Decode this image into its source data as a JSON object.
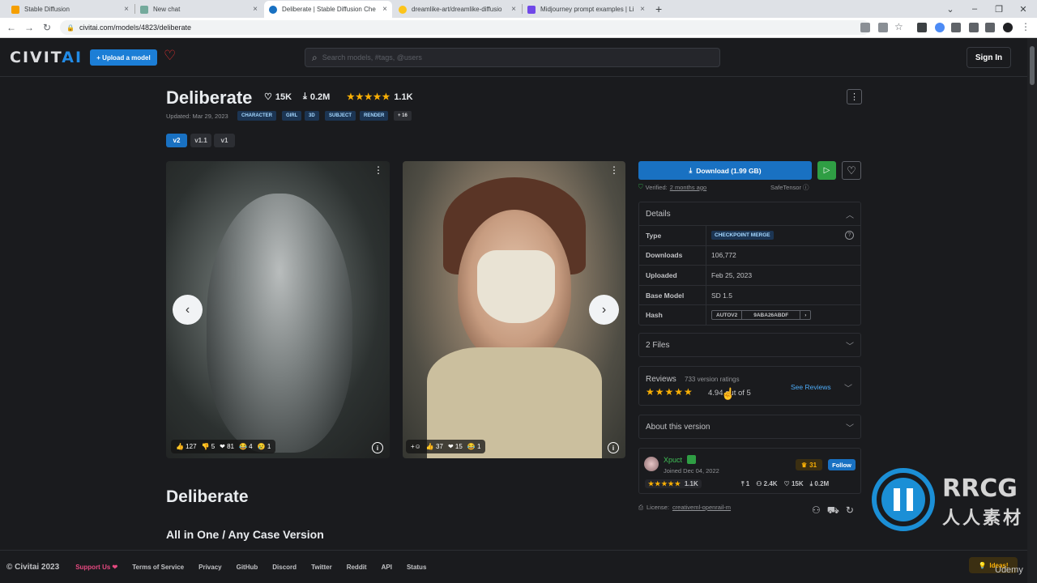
{
  "browser": {
    "tabs": [
      {
        "title": "Stable Diffusion"
      },
      {
        "title": "New chat"
      },
      {
        "title": "Deliberate | Stable Diffusion Che"
      },
      {
        "title": "dreamlike-art/dreamlike-diffusio"
      },
      {
        "title": "Midjourney prompt examples | Li"
      }
    ],
    "url": "civitai.com/models/4823/deliberate",
    "new_tab": "+",
    "close": "×"
  },
  "site": {
    "logo_a": "CIVIT",
    "logo_b": "AI",
    "upload_label": "+ Upload a model",
    "search_placeholder": "Search models, #tags, @users",
    "signin_label": "Sign In"
  },
  "model": {
    "name": "Deliberate",
    "likes": "15K",
    "downloads": "0.2M",
    "rating_count": "1.1K",
    "rating_stars": "★★★★★",
    "updated": "Updated: Mar 29, 2023",
    "tags": [
      "CHARACTER",
      "GIRL",
      "3D",
      "SUBJECT",
      "RENDER",
      "+ 16"
    ],
    "versions": [
      "v2",
      "v1.1",
      "v1"
    ]
  },
  "gallery": {
    "img1_reactions": [
      "👍 127",
      "👎 5",
      "❤ 81",
      "😂 4",
      "😢 1"
    ],
    "img2_add": "+☺",
    "img2_reactions": [
      "👍 37",
      "❤ 15",
      "😂 1"
    ]
  },
  "content": {
    "heading": "Deliberate",
    "subheading": "All in One / Any Case Version"
  },
  "sidebar": {
    "download_label": "Download (1.99 GB)",
    "verified_label": "Verified:",
    "verified_when": "2 months ago",
    "safetensor": "SafeTensor",
    "details_title": "Details",
    "details": {
      "type_k": "Type",
      "type_v": "CHECKPOINT MERGE",
      "downloads_k": "Downloads",
      "downloads_v": "106,772",
      "uploaded_k": "Uploaded",
      "uploaded_v": "Feb 25, 2023",
      "base_k": "Base Model",
      "base_v": "SD 1.5",
      "hash_k": "Hash",
      "hash_algo": "AUTOV2",
      "hash_v": "9ABA26ABDF"
    },
    "files_title": "2 Files",
    "reviews_title": "Reviews",
    "reviews_count": "733 version ratings",
    "reviews_score": "4.94 out of 5",
    "see_reviews": "See Reviews",
    "about_title": "About this version",
    "creator": {
      "name": "Xpuct",
      "joined": "Joined Dec 04, 2022",
      "rank": "31",
      "follow": "Follow",
      "rating_count": "1.1K",
      "uploads": "1",
      "followers": "2.4K",
      "likes": "15K",
      "downloads": "0.2M"
    },
    "license_label": "License:",
    "license_link": "creativeml-openrail-m"
  },
  "footer": {
    "copyright": "© Civitai 2023",
    "links": [
      "Support Us ❤",
      "Terms of Service",
      "Privacy",
      "GitHub",
      "Discord",
      "Twitter",
      "Reddit",
      "API",
      "Status"
    ],
    "ideas": "Ideas!"
  },
  "watermark": {
    "brand": "RRCG",
    "sub": "人人素材",
    "udemy": "Udemy"
  },
  "colors": {
    "accent": "#1971c2",
    "star": "#fab005",
    "green": "#2f9e44"
  }
}
